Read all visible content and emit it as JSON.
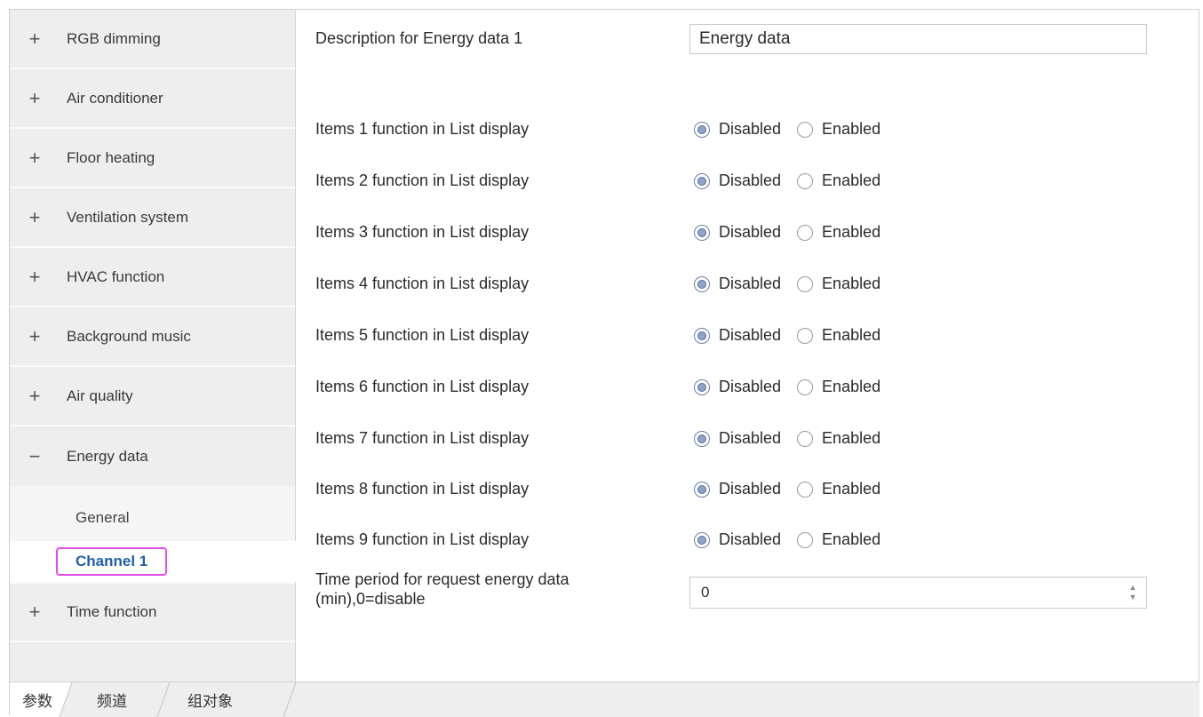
{
  "sidebar": {
    "items": [
      {
        "sign": "+",
        "label": "RGB dimming"
      },
      {
        "sign": "+",
        "label": "Air conditioner"
      },
      {
        "sign": "+",
        "label": "Floor heating"
      },
      {
        "sign": "+",
        "label": "Ventilation system"
      },
      {
        "sign": "+",
        "label": "HVAC function"
      },
      {
        "sign": "+",
        "label": "Background music"
      },
      {
        "sign": "+",
        "label": "Air quality"
      },
      {
        "sign": "−",
        "label": "Energy data"
      }
    ],
    "sub_items": [
      {
        "label": "General"
      },
      {
        "label": "Channel 1"
      }
    ],
    "after_items": [
      {
        "sign": "+",
        "label": "Time function"
      }
    ]
  },
  "main": {
    "description": {
      "label": "Description for Energy data 1",
      "value": "Energy data"
    },
    "list_items": [
      {
        "label": "Items 1 function in List display"
      },
      {
        "label": "Items 2 function in List display"
      },
      {
        "label": "Items 3 function in List display"
      },
      {
        "label": "Items 4 function in List display"
      },
      {
        "label": "Items 5 function in List display"
      },
      {
        "label": "Items 6 function in List display"
      },
      {
        "label": "Items 7 function in List display"
      },
      {
        "label": "Items 8 function in List display"
      },
      {
        "label": "Items 9 function in List display"
      }
    ],
    "radio_options": {
      "disabled": "Disabled",
      "enabled": "Enabled",
      "selected": "Disabled"
    },
    "time_period": {
      "label_line1": "Time period for request energy data",
      "label_line2": "(min),0=disable",
      "value": "0"
    }
  },
  "tabs": [
    {
      "label": "参数"
    },
    {
      "label": "频道"
    },
    {
      "label": "组对象"
    }
  ]
}
